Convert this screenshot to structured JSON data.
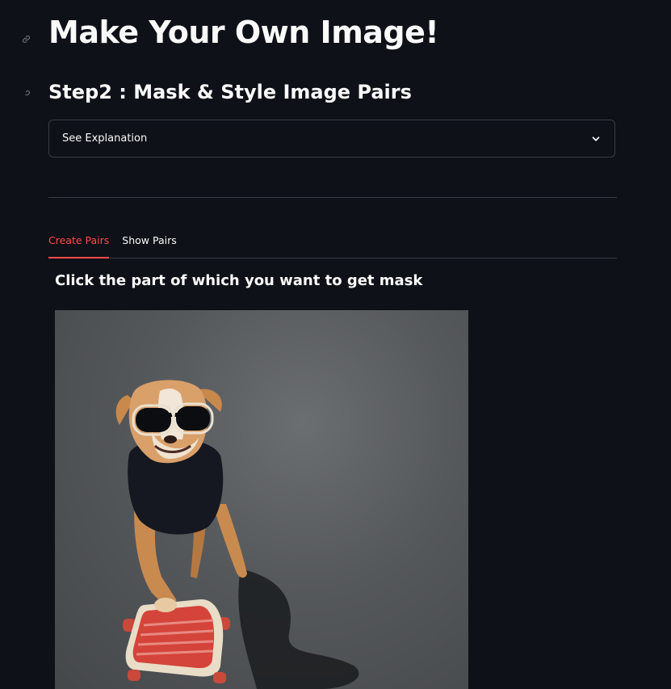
{
  "header": {
    "title": "Make Your Own Image!",
    "step_title": "Step2 : Mask & Style Image Pairs"
  },
  "expander": {
    "label": "See Explanation",
    "icon": "chevron-down-icon"
  },
  "tabs": [
    {
      "label": "Create Pairs",
      "active": true
    },
    {
      "label": "Show Pairs",
      "active": false
    }
  ],
  "main": {
    "instruction": "Click the part of which you want to get mask"
  },
  "colors": {
    "background": "#0e1117",
    "accent": "#ff4b4b",
    "border": "#3a3d46",
    "text": "#fafafa"
  }
}
